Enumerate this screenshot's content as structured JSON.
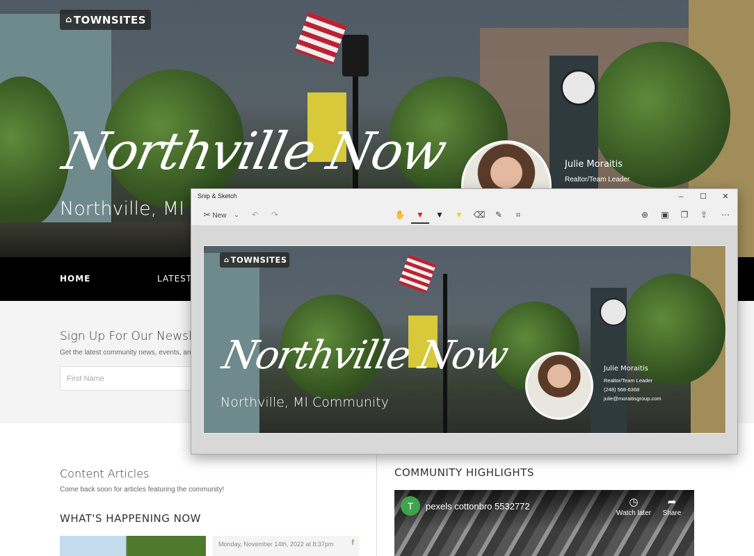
{
  "site": {
    "logo_text": "TOWNSITES",
    "hero_title": "Northville Now",
    "hero_subtitle_visible": "Northville, MI C",
    "agent": {
      "name": "Julie Moraitis",
      "title": "Realtor/Team Leader"
    }
  },
  "nav": {
    "items": [
      "HOME",
      "LATEST"
    ]
  },
  "newsletter": {
    "title": "Sign Up For Our Newsle",
    "description": "Get the latest community news, events, and",
    "first_name_placeholder": "First Name"
  },
  "content": {
    "articles_title": "Content Articles",
    "articles_desc": "Come back soon for articles featuring the community!",
    "happening_title": "WHAT'S HAPPENING NOW",
    "article_date": "Monday, November 14th, 2022 at 8:37pm",
    "highlights_title": "COMMUNITY HIGHLIGHTS"
  },
  "video": {
    "channel_initial": "T",
    "title": "pexels cottonbro 5532772",
    "watch_later": "Watch later",
    "share": "Share"
  },
  "snip_window": {
    "title": "Snip & Sketch",
    "new_label": "New",
    "controls": {
      "minimize": "–",
      "maximize": "☐",
      "close": "✕"
    },
    "canvas": {
      "logo_text": "TOWNSITES",
      "hero_title": "Northville Now",
      "hero_subtitle": "Northville, MI Community",
      "agent_name": "Julie Moraitis",
      "agent_title": "Realtor/Team Leader",
      "agent_phone": "(248) 568-6368",
      "agent_email": "julie@moraitisgroup.com"
    }
  }
}
